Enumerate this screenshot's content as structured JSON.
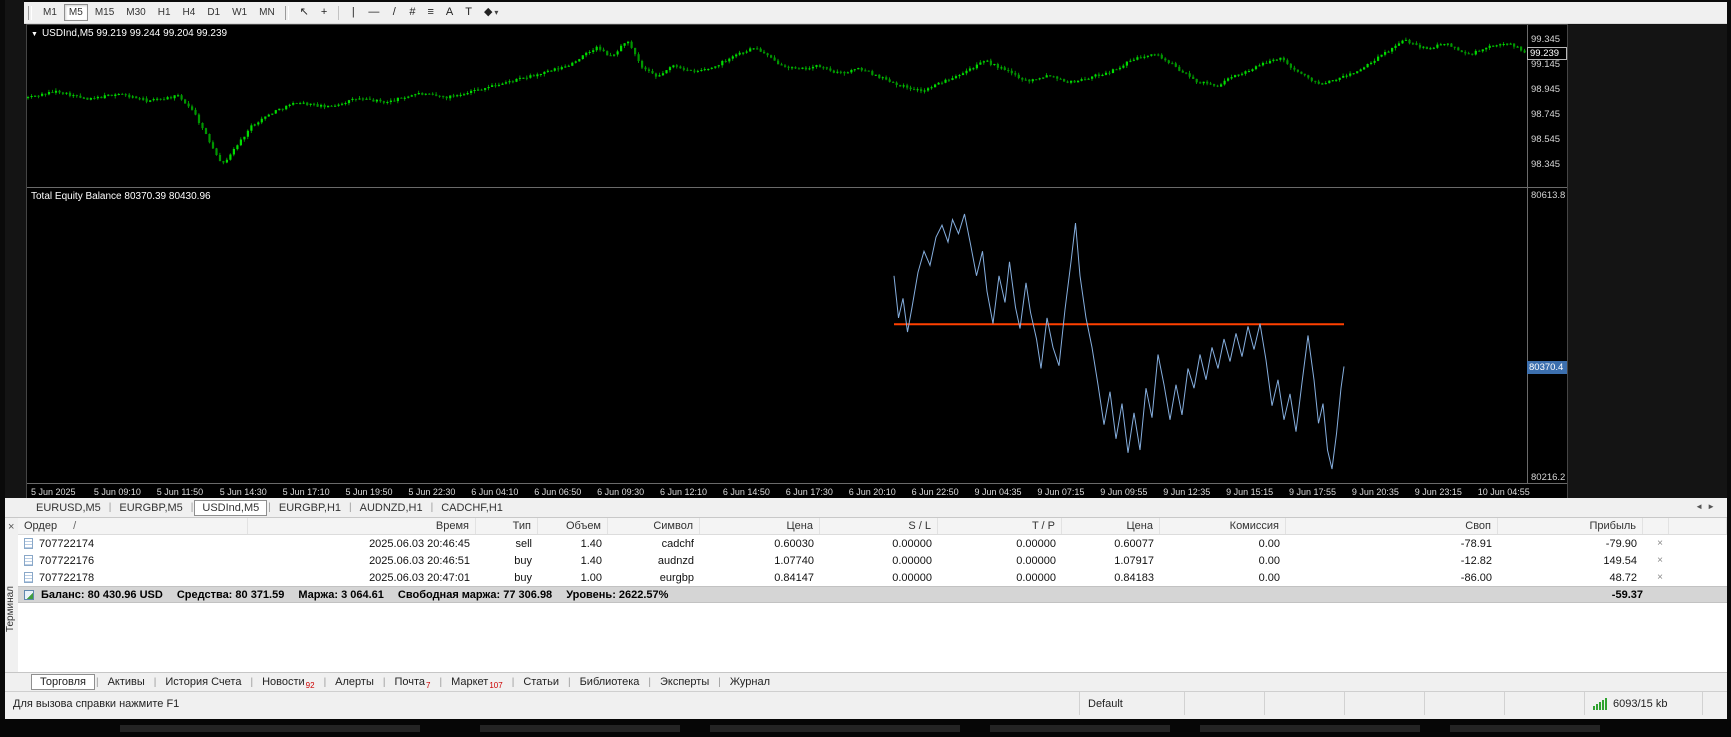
{
  "toolbar": {
    "timeframes": [
      {
        "label": "M1",
        "active": false
      },
      {
        "label": "M5",
        "active": true
      },
      {
        "label": "M15",
        "active": false
      },
      {
        "label": "M30",
        "active": false
      },
      {
        "label": "H1",
        "active": false
      },
      {
        "label": "H4",
        "active": false
      },
      {
        "label": "D1",
        "active": false
      },
      {
        "label": "W1",
        "active": false
      },
      {
        "label": "MN",
        "active": false
      }
    ],
    "tools": [
      {
        "name": "cursor",
        "glyph": "↖"
      },
      {
        "name": "crosshair",
        "glyph": "+"
      },
      {
        "sep": true
      },
      {
        "name": "vertical-line",
        "glyph": "|"
      },
      {
        "name": "horizontal-line",
        "glyph": "—"
      },
      {
        "name": "trend-line",
        "glyph": "/"
      },
      {
        "name": "fibonacci",
        "glyph": "#"
      },
      {
        "name": "objects-list",
        "glyph": "≡"
      },
      {
        "name": "text",
        "glyph": "A"
      },
      {
        "name": "text-label",
        "glyph": "T"
      },
      {
        "name": "shapes-dropdown",
        "glyph": "◆",
        "caret": true
      }
    ]
  },
  "chart": {
    "symbol": "USDInd,M5",
    "ohlc": {
      "open": "99.219",
      "high": "99.244",
      "low": "99.204",
      "close": "99.239"
    },
    "indicator_label": "Total Equity Balance 80370.39 80430.96"
  },
  "chart_data": [
    {
      "type": "candlestick",
      "title": "USDInd,M5",
      "ylim": [
        98.16,
        99.46
      ],
      "y_ticks": [
        99.345,
        99.145,
        98.945,
        98.745,
        98.545,
        98.345
      ],
      "current_price": 99.239,
      "num_candles": 430,
      "up_color": "#00dc00",
      "down_color": "#009600",
      "wick_color": "#00b800",
      "bg": "#000000",
      "anchors_t": [
        0,
        0.02,
        0.04,
        0.06,
        0.08,
        0.1,
        0.11,
        0.12,
        0.13,
        0.14,
        0.15,
        0.165,
        0.18,
        0.2,
        0.22,
        0.24,
        0.26,
        0.28,
        0.3,
        0.32,
        0.34,
        0.36,
        0.38,
        0.39,
        0.4,
        0.41,
        0.42,
        0.432,
        0.444,
        0.458,
        0.472,
        0.486,
        0.5,
        0.514,
        0.528,
        0.542,
        0.556,
        0.57,
        0.584,
        0.598,
        0.612,
        0.626,
        0.64,
        0.654,
        0.668,
        0.682,
        0.696,
        0.71,
        0.724,
        0.738,
        0.752,
        0.766,
        0.78,
        0.794,
        0.808,
        0.822,
        0.836,
        0.85,
        0.864,
        0.878,
        0.892,
        0.906,
        0.92,
        0.934,
        0.948,
        0.962,
        0.976,
        0.99,
        1.0
      ],
      "anchors_price": [
        98.88,
        98.93,
        98.86,
        98.91,
        98.85,
        98.89,
        98.78,
        98.55,
        98.34,
        98.5,
        98.66,
        98.77,
        98.84,
        98.8,
        98.87,
        98.84,
        98.91,
        98.88,
        98.94,
        99.0,
        99.06,
        99.13,
        99.28,
        99.2,
        99.34,
        99.12,
        99.04,
        99.14,
        99.08,
        99.12,
        99.22,
        99.28,
        99.16,
        99.1,
        99.13,
        99.07,
        99.11,
        99.04,
        98.97,
        98.93,
        99.01,
        99.09,
        99.17,
        99.09,
        99.01,
        99.06,
        99.0,
        99.04,
        99.09,
        99.18,
        99.24,
        99.13,
        99.01,
        98.97,
        99.06,
        99.13,
        99.2,
        99.07,
        98.98,
        99.04,
        99.11,
        99.23,
        99.34,
        99.27,
        99.31,
        99.22,
        99.28,
        99.32,
        99.24
      ],
      "x_labels": [
        "5 Jun 2025",
        "5 Jun 09:10",
        "5 Jun 11:50",
        "5 Jun 14:30",
        "5 Jun 17:10",
        "5 Jun 19:50",
        "5 Jun 22:30",
        "6 Jun 04:10",
        "6 Jun 06:50",
        "6 Jun 09:30",
        "6 Jun 12:10",
        "6 Jun 14:50",
        "6 Jun 17:30",
        "6 Jun 20:10",
        "6 Jun 22:50",
        "9 Jun 04:35",
        "9 Jun 07:15",
        "9 Jun 09:55",
        "9 Jun 12:35",
        "9 Jun 15:15",
        "9 Jun 17:55",
        "9 Jun 20:35",
        "9 Jun 23:15",
        "10 Jun 04:55"
      ]
    },
    {
      "type": "line",
      "title": "Total Equity Balance",
      "ylim": [
        80205,
        80625
      ],
      "y_tick_top": "80613.8",
      "y_tick_bottom": "80216.2",
      "current_value": 80370.4,
      "current_label": "80370.4",
      "line_color": "#85aede",
      "balance_line": {
        "value": 80430.96,
        "color": "#ff4000",
        "t_start": 0.578,
        "t_end": 0.878
      },
      "points_t": [
        0.578,
        0.581,
        0.584,
        0.587,
        0.59,
        0.594,
        0.598,
        0.602,
        0.606,
        0.61,
        0.614,
        0.617,
        0.621,
        0.625,
        0.629,
        0.633,
        0.637,
        0.64,
        0.644,
        0.648,
        0.652,
        0.655,
        0.659,
        0.662,
        0.666,
        0.669,
        0.673,
        0.676,
        0.68,
        0.684,
        0.688,
        0.692,
        0.696,
        0.699,
        0.702,
        0.706,
        0.71,
        0.714,
        0.718,
        0.722,
        0.726,
        0.73,
        0.734,
        0.738,
        0.742,
        0.746,
        0.75,
        0.754,
        0.758,
        0.762,
        0.766,
        0.77,
        0.774,
        0.778,
        0.782,
        0.786,
        0.79,
        0.794,
        0.798,
        0.802,
        0.806,
        0.81,
        0.814,
        0.818,
        0.822,
        0.826,
        0.83,
        0.834,
        0.838,
        0.842,
        0.846,
        0.85,
        0.854,
        0.858,
        0.861,
        0.864,
        0.867,
        0.87,
        0.873,
        0.876,
        0.878
      ],
      "points_v": [
        80500,
        80440,
        80468,
        80420,
        80455,
        80505,
        80535,
        80515,
        80555,
        80572,
        80548,
        80580,
        80560,
        80588,
        80545,
        80500,
        80535,
        80478,
        80432,
        80500,
        80462,
        80520,
        80455,
        80425,
        80490,
        80448,
        80410,
        80368,
        80440,
        80398,
        80372,
        80452,
        80520,
        80575,
        80500,
        80440,
        80398,
        80345,
        80288,
        80335,
        80268,
        80318,
        80248,
        80305,
        80252,
        80340,
        80298,
        80388,
        80345,
        80295,
        80345,
        80302,
        80368,
        80340,
        80388,
        80352,
        80398,
        80368,
        80410,
        80378,
        80418,
        80385,
        80428,
        80395,
        80432,
        80380,
        80315,
        80352,
        80295,
        80332,
        80278,
        80348,
        80415,
        80352,
        80290,
        80318,
        80252,
        80225,
        80275,
        80340,
        80371
      ]
    }
  ],
  "chart_tabs": [
    {
      "label": "EURUSD,M5"
    },
    {
      "label": "EURGBP,M5"
    },
    {
      "label": "USDInd,M5",
      "active": true
    },
    {
      "label": "EURGBP,H1"
    },
    {
      "label": "AUDNZD,H1"
    },
    {
      "label": "CADCHF,H1"
    }
  ],
  "terminal": {
    "vertical_label": "Терминал",
    "close_glyph": "×",
    "sort_indicator": "/",
    "columns": [
      "Ордер",
      "Время",
      "Тип",
      "Объем",
      "Символ",
      "Цена",
      "S / L",
      "T / P",
      "Цена",
      "Комиссия",
      "Своп",
      "Прибыль"
    ],
    "column_keys": [
      "order",
      "time",
      "type",
      "volume",
      "symbol",
      "price-open",
      "sl",
      "tp",
      "price-current",
      "commission",
      "swap",
      "profit"
    ],
    "orders": [
      {
        "order": "707722174",
        "time": "2025.06.03 20:46:45",
        "type": "sell",
        "volume": "1.40",
        "symbol": "cadchf",
        "price": "0.60030",
        "sl": "0.00000",
        "tp": "0.00000",
        "price_current": "0.60077",
        "commission": "0.00",
        "swap": "-78.91",
        "profit": "-79.90"
      },
      {
        "order": "707722176",
        "time": "2025.06.03 20:46:51",
        "type": "buy",
        "volume": "1.40",
        "symbol": "audnzd",
        "price": "1.07740",
        "sl": "0.00000",
        "tp": "0.00000",
        "price_current": "1.07917",
        "commission": "0.00",
        "swap": "-12.82",
        "profit": "149.54"
      },
      {
        "order": "707722178",
        "time": "2025.06.03 20:47:01",
        "type": "buy",
        "volume": "1.00",
        "symbol": "eurgbp",
        "price": "0.84147",
        "sl": "0.00000",
        "tp": "0.00000",
        "price_current": "0.84183",
        "commission": "0.00",
        "swap": "-86.00",
        "profit": "48.72"
      }
    ],
    "balance_parts": [
      "Баланс: 80 430.96 USD",
      "Средства: 80 371.59",
      "Маржа: 3 064.61",
      "Свободная маржа: 77 306.98",
      "Уровень: 2622.57%"
    ],
    "total_profit": "-59.37"
  },
  "bottom_tabs": [
    {
      "label": "Торговля",
      "name": "trade",
      "active": true
    },
    {
      "label": "Активы",
      "name": "assets"
    },
    {
      "label": "История Счета",
      "name": "account-history"
    },
    {
      "label": "Новости",
      "name": "news",
      "badge": "92"
    },
    {
      "label": "Алерты",
      "name": "alerts"
    },
    {
      "label": "Почта",
      "name": "mailbox",
      "badge": "7"
    },
    {
      "label": "Маркет",
      "name": "market",
      "badge": "107"
    },
    {
      "label": "Статьи",
      "name": "articles"
    },
    {
      "label": "Библиотека",
      "name": "library"
    },
    {
      "label": "Эксперты",
      "name": "experts"
    },
    {
      "label": "Журнал",
      "name": "journal"
    }
  ],
  "status_bar": {
    "help": "Для вызова справки нажмите F1",
    "profile": "Default",
    "connection": "6093/15 kb"
  }
}
